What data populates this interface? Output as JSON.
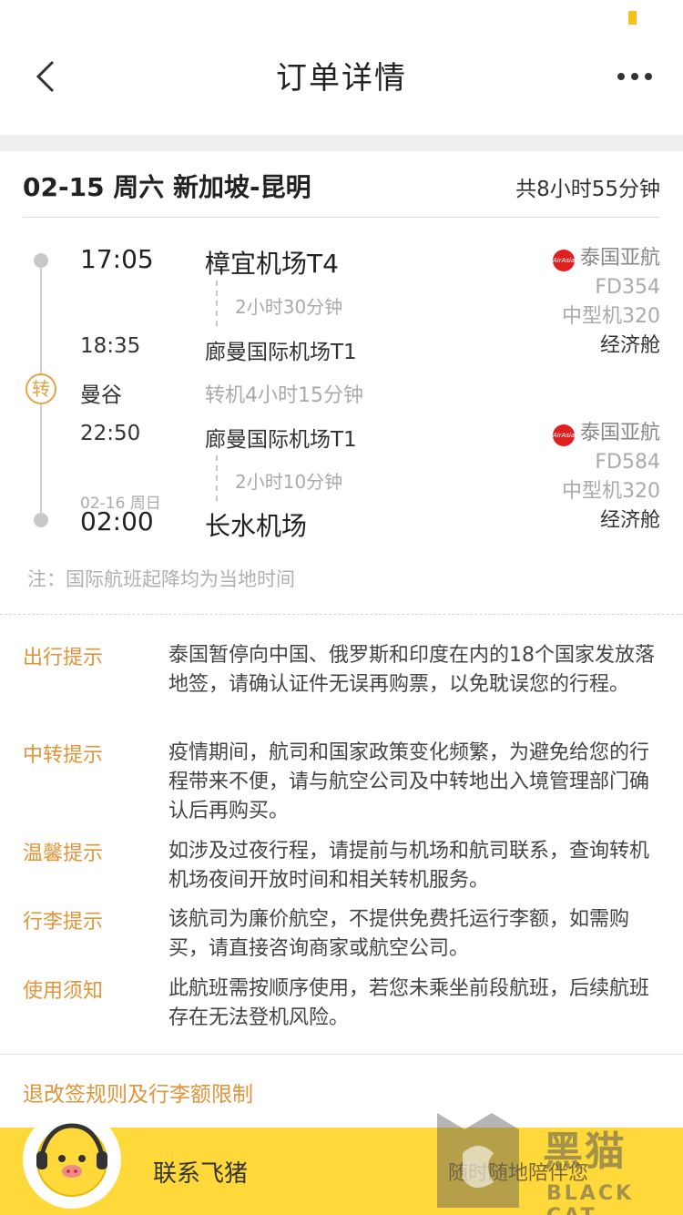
{
  "header": {
    "title": "订单详情"
  },
  "trip": {
    "date": "02-15 周六 新加坡-昆明",
    "total_duration": "共8小时55分钟"
  },
  "segment1": {
    "dep_time": "17:05",
    "dep_airport": "樟宜机场T4",
    "fly_duration": "2小时30分钟",
    "arr_time": "18:35",
    "arr_airport": "廊曼国际机场T1",
    "airline_logo": "AirAsia",
    "airline": "泰国亚航",
    "flight_no": "FD354",
    "aircraft": "中型机320",
    "cabin": "经济舱"
  },
  "transfer": {
    "badge": "转",
    "city": "曼谷",
    "duration": "转机4小时15分钟"
  },
  "segment2": {
    "dep_time": "22:50",
    "dep_airport": "廊曼国际机场T1",
    "fly_duration": "2小时10分钟",
    "arr_date": "02-16 周日",
    "arr_time": "02:00",
    "arr_airport": "长水机场",
    "airline_logo": "AirAsia",
    "airline": "泰国亚航",
    "flight_no": "FD584",
    "aircraft": "中型机320",
    "cabin": "经济舱"
  },
  "note": "注：国际航班起降均为当地时间",
  "tips": [
    {
      "label": "出行提示",
      "text": "泰国暂停向中国、俄罗斯和印度在内的18个国家发放落地签，请确认证件无误再购票，以免耽误您的行程。"
    },
    {
      "label": "中转提示",
      "text": "疫情期间，航司和国家政策变化频繁，为避免给您的行程带来不便，请与航空公司及中转地出入境管理部门确认后再购买。"
    },
    {
      "label": "温馨提示",
      "text": "如涉及过夜行程，请提前与机场和航司联系，查询转机机场夜间开放时间和相关转机服务。"
    },
    {
      "label": "行李提示",
      "text": "该航司为廉价航空，不提供免费托运行李额，如需购买，请直接咨询商家或航空公司。"
    },
    {
      "label": "使用须知",
      "text": "此航班需按顺序使用，若您未乘坐前段航班，后续航班存在无法登机风险。"
    }
  ],
  "rules_link": "退改签规则及行李额限制",
  "bottom": {
    "contact": "联系飞猪",
    "service": "随时随地陪伴您"
  },
  "watermark": {
    "cn": "黑猫",
    "en": "BLACK CAT"
  },
  "colors": {
    "accent": "#e0953a",
    "bar": "#ffd83a"
  }
}
